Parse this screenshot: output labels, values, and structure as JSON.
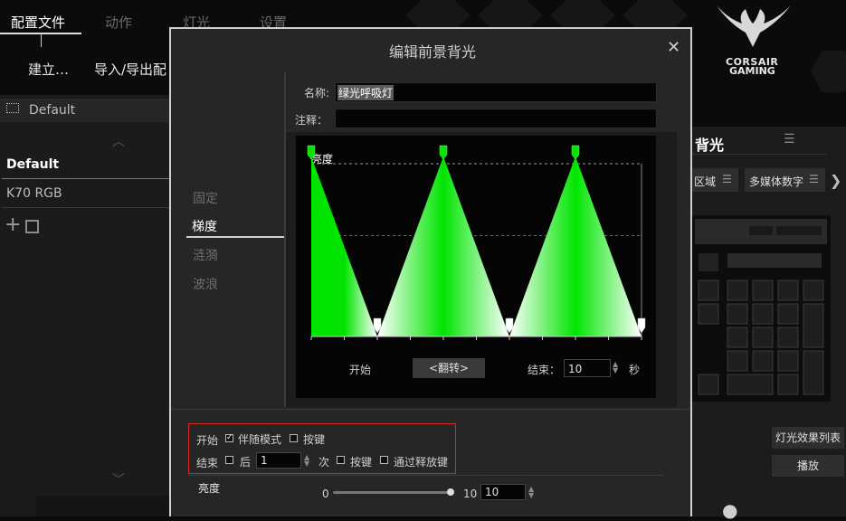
{
  "nav": {
    "tabs": [
      {
        "label": "配置文件",
        "active": true
      },
      {
        "label": "动作",
        "active": false
      },
      {
        "label": "灯光",
        "active": false
      },
      {
        "label": "设置",
        "active": false
      }
    ]
  },
  "left": {
    "create_label": "建立…",
    "import_export_label": "导入/导出配",
    "selected_profile": "Default",
    "profiles": [
      "Default",
      "K70 RGB"
    ]
  },
  "brand": {
    "line1": "CORSAIR",
    "line2": "GAMING"
  },
  "right": {
    "section_title": "背光",
    "zone_label": "区域",
    "media_label": "多媒体数字",
    "effect_list_label": "灯光效果列表",
    "play_label": "播放"
  },
  "modal": {
    "title": "编辑前景背光",
    "close_symbol": "✕",
    "name_label": "名称:",
    "name_value": "绿光呼吸灯",
    "note_label": "注释：",
    "note_value": "",
    "effects": [
      {
        "label": "固定",
        "active": false
      },
      {
        "label": "梯度",
        "active": true
      },
      {
        "label": "涟漪",
        "active": false
      },
      {
        "label": "波浪",
        "active": false
      }
    ],
    "graph": {
      "brightness_label": "亮度",
      "start_label": "开始",
      "flip_label": "<翻转>",
      "end_label": "结束：",
      "end_value": "10",
      "unit_seconds": "秒",
      "fill_color": "#00e400",
      "keyframes": [
        {
          "t": 0,
          "level": 1
        },
        {
          "t": 2,
          "level": 0
        },
        {
          "t": 4,
          "level": 1
        },
        {
          "t": 6,
          "level": 0
        },
        {
          "t": 8,
          "level": 1
        },
        {
          "t": 10,
          "level": 0
        }
      ]
    },
    "trigger": {
      "start_label": "开始",
      "with_mode_label": "伴随模式",
      "with_mode_checked": true,
      "start_key_label": "按键",
      "end_label": "结束",
      "after_label": "后",
      "after_value": "1",
      "times_label": "次",
      "end_key_label": "按键",
      "release_label": "通过释放键"
    },
    "brightness": {
      "label": "亮度",
      "min": "0",
      "max": "10",
      "value": "10",
      "level": 1.0
    }
  },
  "colors": {
    "accent_green": "#00e400",
    "border_red": "#d72828",
    "modal_border": "#cfcfcf"
  }
}
